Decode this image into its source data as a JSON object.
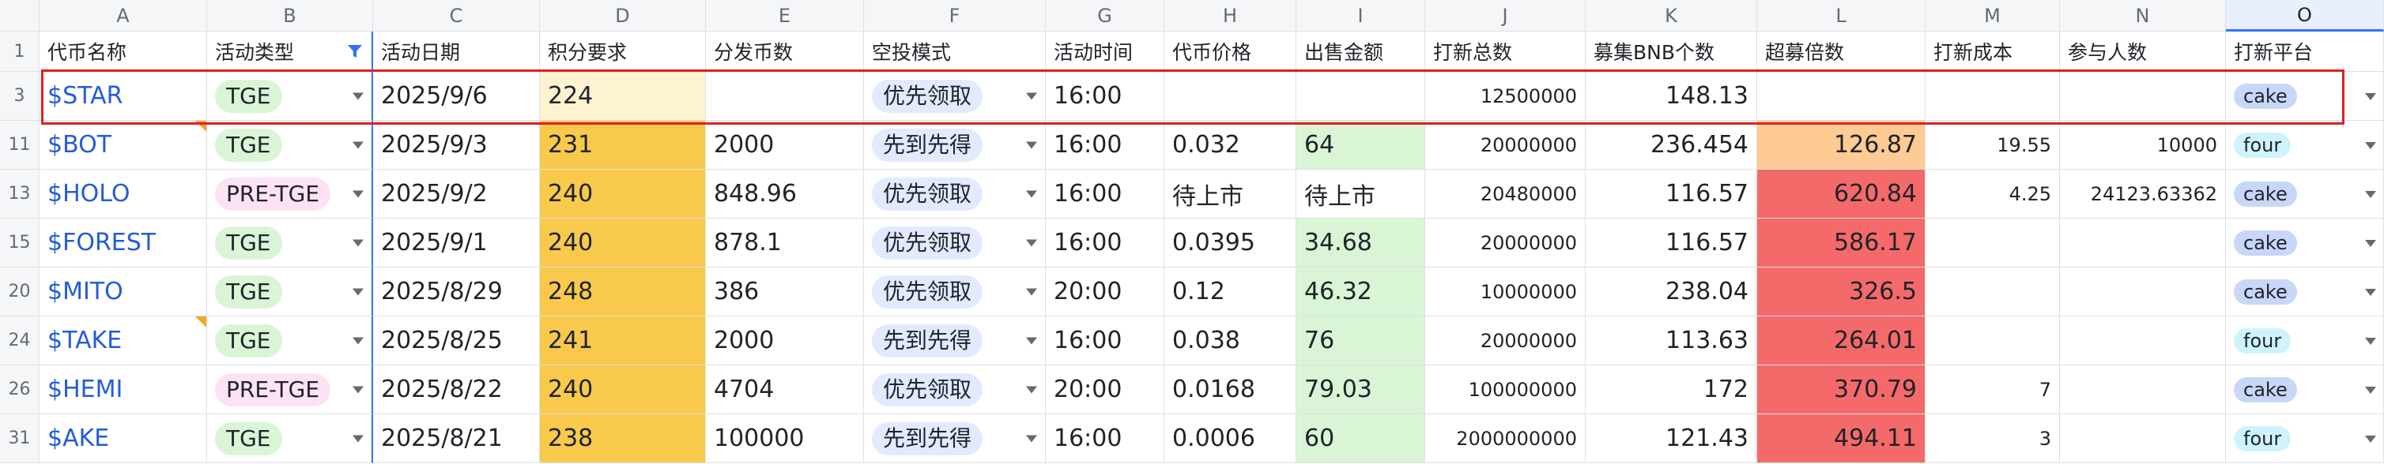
{
  "columns": [
    {
      "letter": "A",
      "header": "代币名称"
    },
    {
      "letter": "B",
      "header": "活动类型"
    },
    {
      "letter": "C",
      "header": "活动日期"
    },
    {
      "letter": "D",
      "header": "积分要求"
    },
    {
      "letter": "E",
      "header": "分发币数"
    },
    {
      "letter": "F",
      "header": "空投模式"
    },
    {
      "letter": "G",
      "header": "活动时间"
    },
    {
      "letter": "H",
      "header": "代币价格"
    },
    {
      "letter": "I",
      "header": "出售金额"
    },
    {
      "letter": "J",
      "header": "打新总数"
    },
    {
      "letter": "K",
      "header": "募集BNB个数"
    },
    {
      "letter": "L",
      "header": "超募倍数"
    },
    {
      "letter": "M",
      "header": "打新成本"
    },
    {
      "letter": "N",
      "header": "参与人数"
    },
    {
      "letter": "O",
      "header": "打新平台"
    }
  ],
  "header_row_number": "1",
  "colors": {
    "accent": "#3370ff",
    "highlight_border": "#e02020",
    "link": "#245bdb"
  },
  "rows": [
    {
      "num": "3",
      "token": "$STAR",
      "type": "TGE",
      "date": "2025/9/6",
      "points": "224",
      "distributed": "",
      "mode": "优先领取",
      "time": "16:00",
      "price": "",
      "sale": "",
      "total": "12500000",
      "bnb": "148.13",
      "multiple": "",
      "cost": "",
      "participants": "",
      "platform": "cake",
      "note": false
    },
    {
      "num": "11",
      "token": "$BOT",
      "type": "TGE",
      "date": "2025/9/3",
      "points": "231",
      "distributed": "2000",
      "mode": "先到先得",
      "time": "16:00",
      "price": "0.032",
      "sale": "64",
      "total": "20000000",
      "bnb": "236.454",
      "multiple": "126.87",
      "cost": "19.55",
      "participants": "10000",
      "platform": "four",
      "note": true
    },
    {
      "num": "13",
      "token": "$HOLO",
      "type": "PRE-TGE",
      "date": "2025/9/2",
      "points": "240",
      "distributed": "848.96",
      "mode": "优先领取",
      "time": "16:00",
      "price": "待上市",
      "sale": "待上市",
      "total": "20480000",
      "bnb": "116.57",
      "multiple": "620.84",
      "cost": "4.25",
      "participants": "24123.63362",
      "platform": "cake",
      "note": false
    },
    {
      "num": "15",
      "token": "$FOREST",
      "type": "TGE",
      "date": "2025/9/1",
      "points": "240",
      "distributed": "878.1",
      "mode": "优先领取",
      "time": "16:00",
      "price": "0.0395",
      "sale": "34.68",
      "total": "20000000",
      "bnb": "116.57",
      "multiple": "586.17",
      "cost": "",
      "participants": "",
      "platform": "cake",
      "note": false
    },
    {
      "num": "20",
      "token": "$MITO",
      "type": "TGE",
      "date": "2025/8/29",
      "points": "248",
      "distributed": "386",
      "mode": "优先领取",
      "time": "20:00",
      "price": "0.12",
      "sale": "46.32",
      "total": "10000000",
      "bnb": "238.04",
      "multiple": "326.5",
      "cost": "",
      "participants": "",
      "platform": "cake",
      "note": false
    },
    {
      "num": "24",
      "token": "$TAKE",
      "type": "TGE",
      "date": "2025/8/25",
      "points": "241",
      "distributed": "2000",
      "mode": "先到先得",
      "time": "16:00",
      "price": "0.038",
      "sale": "76",
      "total": "20000000",
      "bnb": "113.63",
      "multiple": "264.01",
      "cost": "",
      "participants": "",
      "platform": "four",
      "note": true
    },
    {
      "num": "26",
      "token": "$HEMI",
      "type": "PRE-TGE",
      "date": "2025/8/22",
      "points": "240",
      "distributed": "4704",
      "mode": "优先领取",
      "time": "20:00",
      "price": "0.0168",
      "sale": "79.03",
      "total": "100000000",
      "bnb": "172",
      "multiple": "370.79",
      "cost": "7",
      "participants": "",
      "platform": "cake",
      "note": false
    },
    {
      "num": "31",
      "token": "$AKE",
      "type": "TGE",
      "date": "2025/8/21",
      "points": "238",
      "distributed": "100000",
      "mode": "先到先得",
      "time": "16:00",
      "price": "0.0006",
      "sale": "60",
      "total": "2000000000",
      "bnb": "121.43",
      "multiple": "494.11",
      "cost": "3",
      "participants": "",
      "platform": "four",
      "note": false
    }
  ]
}
